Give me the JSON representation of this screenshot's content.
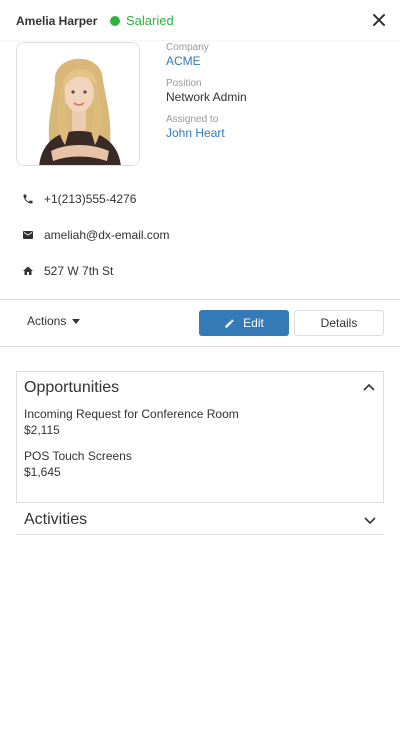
{
  "header": {
    "name": "Amelia Harper",
    "status": "Salaried",
    "status_color": "#2bb53d"
  },
  "photo": {
    "alt": "employee photo"
  },
  "info": {
    "company_label": "Company",
    "company_value": "ACME",
    "position_label": "Position",
    "position_value": "Network Admin",
    "assigned_label": "Assigned to",
    "assigned_value": "John Heart"
  },
  "contacts": {
    "phone": "+1(213)555-4276",
    "email": "ameliah@dx-email.com",
    "address": "527 W 7th St"
  },
  "toolbar": {
    "actions_label": "Actions",
    "edit_label": "Edit",
    "details_label": "Details",
    "accent": "#337ab7"
  },
  "opportunities": {
    "title": "Opportunities",
    "items": [
      {
        "name": "Incoming Request for Conference Room",
        "amount": "$2,115"
      },
      {
        "name": "POS Touch Screens",
        "amount": "$1,645"
      }
    ]
  },
  "activities": {
    "title": "Activities"
  }
}
